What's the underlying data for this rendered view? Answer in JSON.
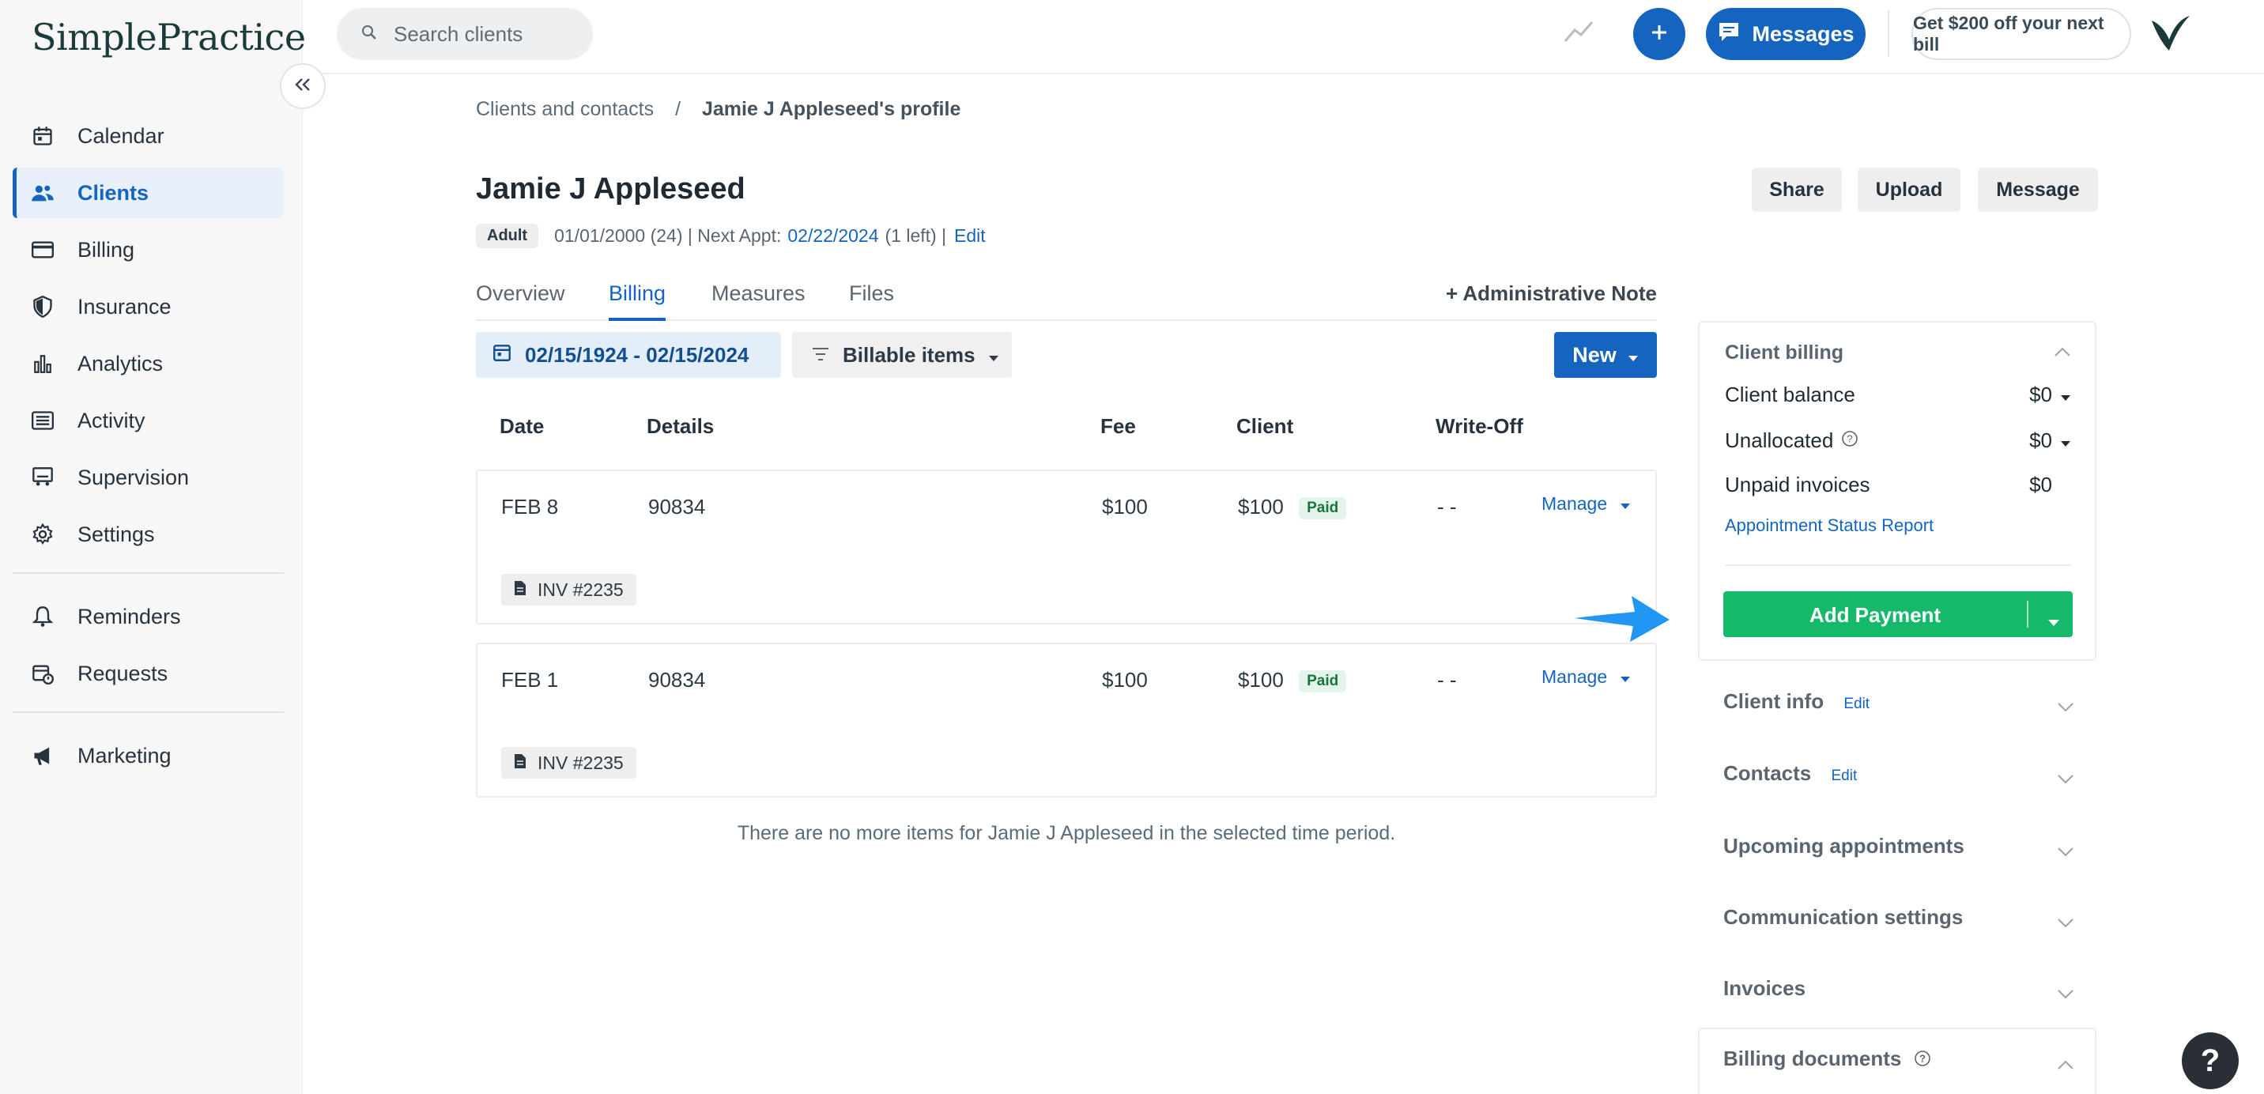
{
  "brand": {
    "logo_text": "SimplePractice"
  },
  "search": {
    "placeholder": "Search clients"
  },
  "topbar": {
    "messages_label": "Messages",
    "promo_label": "Get $200 off your next bill"
  },
  "sidebar": {
    "items": [
      {
        "label": "Calendar",
        "icon": "calendar-icon",
        "active": false
      },
      {
        "label": "Clients",
        "icon": "clients-icon",
        "active": true
      },
      {
        "label": "Billing",
        "icon": "credit-card-icon",
        "active": false
      },
      {
        "label": "Insurance",
        "icon": "shield-icon",
        "active": false
      },
      {
        "label": "Analytics",
        "icon": "bar-chart-icon",
        "active": false
      },
      {
        "label": "Activity",
        "icon": "list-icon",
        "active": false
      },
      {
        "label": "Supervision",
        "icon": "supervision-icon",
        "active": false
      },
      {
        "label": "Settings",
        "icon": "gear-icon",
        "active": false
      }
    ],
    "secondary": [
      {
        "label": "Reminders",
        "icon": "bell-icon"
      },
      {
        "label": "Requests",
        "icon": "calendar-request-icon"
      }
    ],
    "tertiary": [
      {
        "label": "Marketing",
        "icon": "megaphone-icon"
      }
    ]
  },
  "breadcrumb": {
    "parent": "Clients and contacts",
    "separator": "/",
    "current": "Jamie J Appleseed's profile"
  },
  "client": {
    "name": "Jamie J Appleseed",
    "badge": "Adult",
    "dob_info": "01/01/2000 (24) | Next Appt:",
    "next_appt": "02/22/2024",
    "left_info": "(1 left) |",
    "edit": "Edit"
  },
  "header_buttons": {
    "share": "Share",
    "upload": "Upload",
    "message": "Message"
  },
  "tabs": [
    {
      "label": "Overview",
      "active": false
    },
    {
      "label": "Billing",
      "active": true
    },
    {
      "label": "Measures",
      "active": false
    },
    {
      "label": "Files",
      "active": false
    }
  ],
  "admin_note": "+ Administrative Note",
  "filters": {
    "date_range": "02/15/1924 - 02/15/2024",
    "billable": "Billable items",
    "new": "New"
  },
  "table": {
    "headers": [
      "Date",
      "Details",
      "Fee",
      "Client",
      "Write-Off"
    ],
    "rows": [
      {
        "date": "FEB 8",
        "details": "90834",
        "fee": "$100",
        "client": "$100",
        "status": "Paid",
        "writeoff": "- -",
        "manage": "Manage",
        "invoice": "INV #2235"
      },
      {
        "date": "FEB 1",
        "details": "90834",
        "fee": "$100",
        "client": "$100",
        "status": "Paid",
        "writeoff": "- -",
        "manage": "Manage",
        "invoice": "INV #2235"
      }
    ],
    "empty_message": "There are no more items for Jamie J Appleseed in the selected time period."
  },
  "billing_panel": {
    "title": "Client billing",
    "client_balance_label": "Client balance",
    "client_balance": "$0",
    "unallocated_label": "Unallocated",
    "unallocated": "$0",
    "unpaid_label": "Unpaid invoices",
    "unpaid": "$0",
    "report_link": "Appointment Status Report",
    "add_payment": "Add Payment"
  },
  "accordions": {
    "client_info": "Client info",
    "client_info_edit": "Edit",
    "contacts": "Contacts",
    "contacts_edit": "Edit",
    "upcoming": "Upcoming appointments",
    "communication": "Communication settings",
    "invoices": "Invoices",
    "billing_documents": "Billing documents"
  },
  "help": "?",
  "colors": {
    "primary": "#1565c0",
    "success": "#16b86a",
    "annotation_arrow": "#2196f3"
  }
}
